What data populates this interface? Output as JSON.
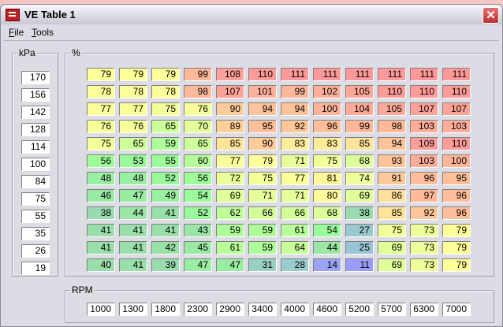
{
  "window": {
    "title": "VE Table 1",
    "close_label": "✕"
  },
  "menu": [
    {
      "label": "File"
    },
    {
      "label": "Tools"
    }
  ],
  "kpa_group": {
    "label": "kPa",
    "values": [
      "170",
      "156",
      "142",
      "128",
      "114",
      "100",
      "84",
      "75",
      "55",
      "35",
      "26",
      "19"
    ]
  },
  "table_group": {
    "label": "%"
  },
  "rpm_group": {
    "label": "RPM",
    "values": [
      "1000",
      "1300",
      "1800",
      "2300",
      "2900",
      "3400",
      "4000",
      "4600",
      "5200",
      "5700",
      "6300",
      "7000"
    ]
  },
  "ve_table": [
    [
      79,
      79,
      79,
      99,
      108,
      110,
      111,
      111,
      111,
      111,
      111,
      111
    ],
    [
      78,
      78,
      78,
      98,
      107,
      101,
      99,
      102,
      105,
      110,
      110,
      110
    ],
    [
      77,
      77,
      75,
      76,
      90,
      94,
      94,
      100,
      104,
      105,
      107,
      107
    ],
    [
      76,
      76,
      65,
      70,
      89,
      95,
      92,
      96,
      99,
      98,
      103,
      103
    ],
    [
      75,
      65,
      59,
      65,
      85,
      90,
      83,
      83,
      85,
      94,
      109,
      110
    ],
    [
      56,
      53,
      55,
      60,
      77,
      79,
      71,
      75,
      68,
      93,
      103,
      100
    ],
    [
      48,
      48,
      52,
      56,
      72,
      75,
      77,
      81,
      74,
      91,
      96,
      95
    ],
    [
      46,
      47,
      49,
      54,
      69,
      71,
      71,
      80,
      69,
      86,
      97,
      96
    ],
    [
      38,
      44,
      41,
      52,
      62,
      66,
      66,
      68,
      38,
      85,
      92,
      96
    ],
    [
      41,
      41,
      41,
      43,
      59,
      59,
      61,
      54,
      27,
      75,
      73,
      79
    ],
    [
      41,
      41,
      42,
      45,
      61,
      59,
      64,
      44,
      25,
      69,
      73,
      79
    ],
    [
      40,
      41,
      39,
      47,
      47,
      31,
      28,
      14,
      11,
      69,
      73,
      79
    ]
  ],
  "colors": {
    "low": "#9999ff",
    "mid_low": "#99cccc",
    "green": "#99ff99",
    "yellow": "#ffff99",
    "orange": "#ffcc99",
    "high": "#ff9999"
  }
}
